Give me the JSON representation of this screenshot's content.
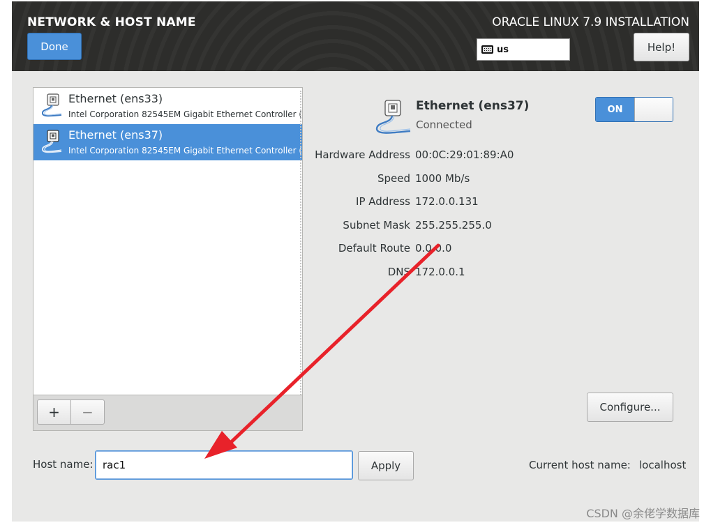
{
  "header": {
    "screen_title": "NETWORK & HOST NAME",
    "done_label": "Done",
    "product_title": "ORACLE LINUX 7.9 INSTALLATION",
    "keyboard_layout": "us",
    "help_label": "Help!"
  },
  "devices": {
    "items": [
      {
        "name": "Ethernet (ens33)",
        "description": "Intel Corporation 82545EM Gigabit Ethernet Controller (",
        "selected": false
      },
      {
        "name": "Ethernet (ens37)",
        "description": "Intel Corporation 82545EM Gigabit Ethernet Controller (",
        "selected": true
      }
    ],
    "add_label": "+",
    "remove_label": "−"
  },
  "details": {
    "name": "Ethernet (ens37)",
    "status": "Connected",
    "toggle_label": "ON",
    "properties": [
      {
        "label": "Hardware Address",
        "value": "00:0C:29:01:89:A0"
      },
      {
        "label": "Speed",
        "value": "1000 Mb/s"
      },
      {
        "label": "IP Address",
        "value": "172.0.0.131"
      },
      {
        "label": "Subnet Mask",
        "value": "255.255.255.0"
      },
      {
        "label": "Default Route",
        "value": "0.0.0.0"
      },
      {
        "label": "DNS",
        "value": "172.0.0.1"
      }
    ],
    "configure_label": "Configure..."
  },
  "hostname": {
    "label": "Host name:",
    "value": "rac1",
    "apply_label": "Apply",
    "current_label": "Current host name:",
    "current_value": "localhost"
  },
  "watermark": "CSDN @余佬学数据库",
  "colors": {
    "accent": "#4a90d9",
    "header_bg": "#2d2d2b",
    "annotation_arrow": "#e8222a"
  }
}
